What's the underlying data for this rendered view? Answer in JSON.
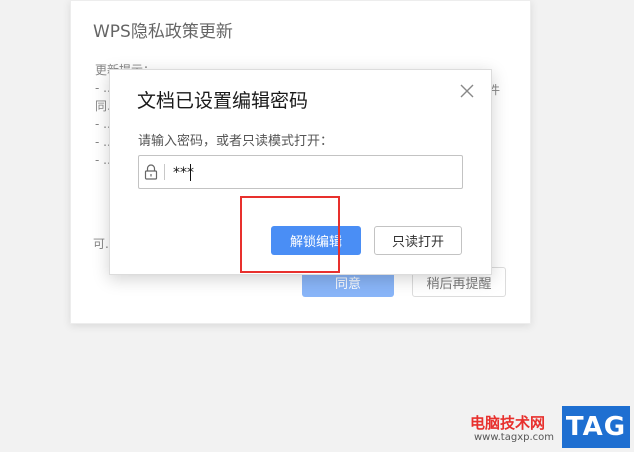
{
  "privacy_dialog": {
    "title": "WPS隐私政策更新",
    "lines": [
      "更新提示：",
      "- ...",
      "同...",
      "- ...",
      "- ...",
      "- ..."
    ],
    "side_char": "件",
    "footer_prefix": "可...",
    "agree_label": "同意",
    "later_label": "稍后再提醒"
  },
  "password_dialog": {
    "title": "文档已设置编辑密码",
    "hint": "请输入密码，或者只读模式打开：",
    "password_value": "***",
    "unlock_label": "解锁编辑",
    "readonly_label": "只读打开"
  },
  "watermark": {
    "site_name": "电脑技术网",
    "url": "www.tagxp.com",
    "logo": "TAG"
  },
  "colors": {
    "primary_button": "#4a8ef5",
    "highlight": "#e8302d"
  }
}
